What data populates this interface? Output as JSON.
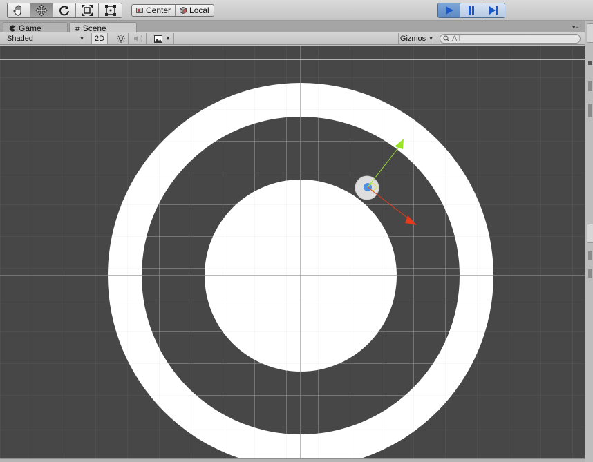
{
  "toolbar": {
    "tools": [
      "hand-tool",
      "move-tool",
      "rotate-tool",
      "scale-tool",
      "rect-tool"
    ],
    "active_tool_index": 1,
    "pivot_center_label": "Center",
    "pivot_local_label": "Local",
    "play_controls": [
      "play",
      "pause",
      "step"
    ]
  },
  "tabs": [
    {
      "label": "Game",
      "active": false
    },
    {
      "label": "Scene",
      "active": true
    }
  ],
  "scene_toolbar": {
    "shading_mode": "Shaded",
    "mode_2d_label": "2D",
    "gizmos_label": "Gizmos",
    "search_placeholder": "All"
  },
  "colors": {
    "viewport_bg": "#474747",
    "ring_white": "#ffffff",
    "grid_line": "#5a5a5a",
    "axis_y_green": "#9be22c",
    "axis_x_red": "#e5391c",
    "play_blue": "#6a97cf",
    "gizmo_blue": "#4c8fe6"
  }
}
